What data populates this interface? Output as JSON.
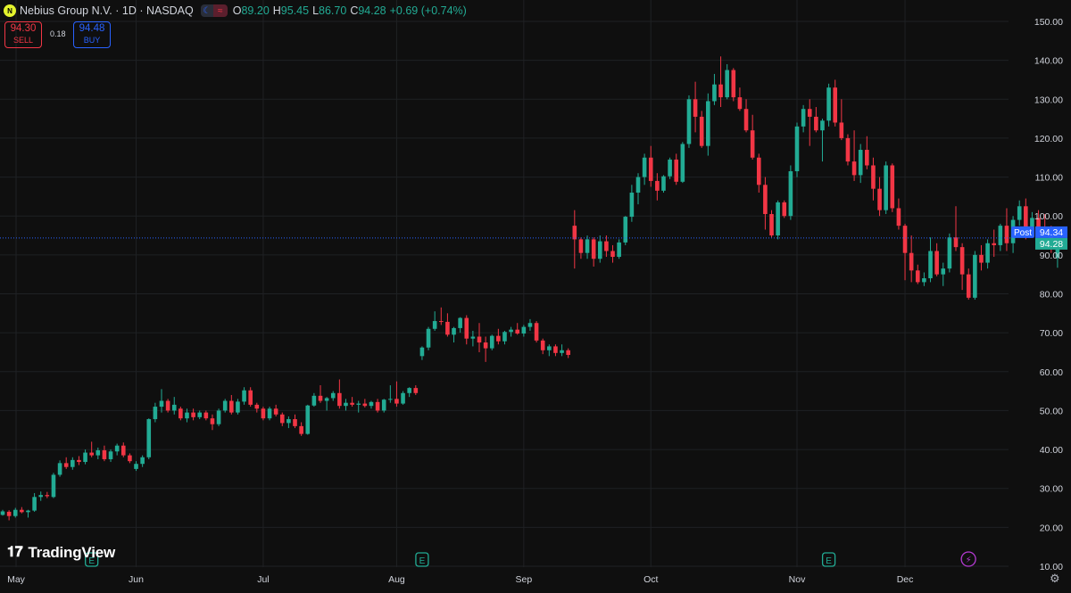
{
  "header": {
    "title": "Nebius Group N.V. · 1D · NASDAQ",
    "logo": "N",
    "o_label": "O",
    "o_value": "89.20",
    "h_label": "H",
    "h_value": "95.45",
    "l_label": "L",
    "l_value": "86.70",
    "c_label": "C",
    "c_value": "94.28",
    "change": "+0.69 (+0.74%)"
  },
  "trade": {
    "sell_price": "94.30",
    "sell_label": "SELL",
    "spread": "0.18",
    "buy_price": "94.48",
    "buy_label": "BUY"
  },
  "brand": "TradingView",
  "icons": [
    "tradingview-logo-icon",
    "gear-icon",
    "earnings-icon",
    "dividend-icon",
    "moon-icon",
    "wave-icon"
  ],
  "colors": {
    "background": "#0f0f0f",
    "up": "#22ab94",
    "down": "#f23645",
    "grid": "#1f2124",
    "post_label": "#2962ff",
    "earnings": "#22ab94",
    "event": "#b53ad3"
  },
  "chart_data": {
    "type": "candlestick",
    "ylim": [
      10,
      150
    ],
    "y_ticks": [
      "10.00",
      "20.00",
      "30.00",
      "40.00",
      "50.00",
      "60.00",
      "70.00",
      "80.00",
      "90.00",
      "100.00",
      "110.00",
      "120.00",
      "130.00",
      "140.00",
      "150.00"
    ],
    "x_ticks": [
      {
        "label": "May",
        "index": 0
      },
      {
        "label": "Jun",
        "index": 21
      },
      {
        "label": "Jul",
        "index": 41
      },
      {
        "label": "Aug",
        "index": 62
      },
      {
        "label": "Sep",
        "index": 82
      },
      {
        "label": "Oct",
        "index": 102
      },
      {
        "label": "Nov",
        "index": 125
      },
      {
        "label": "Dec",
        "index": 142
      }
    ],
    "earnings_markers": [
      {
        "label": "E",
        "index": 14
      },
      {
        "label": "E",
        "index": 66
      },
      {
        "label": "E",
        "index": 130
      }
    ],
    "event_markers": [
      {
        "label": "⚡",
        "index": 151
      }
    ],
    "post_price": {
      "label": "Post",
      "value": 94.34
    },
    "last_price": 94.28,
    "ohlc": [
      [
        23.2,
        24.5,
        23.0,
        24.1
      ],
      [
        24.0,
        24.4,
        21.8,
        22.9
      ],
      [
        22.9,
        25.0,
        22.5,
        24.5
      ],
      [
        24.5,
        25.2,
        23.6,
        23.9
      ],
      [
        23.9,
        24.5,
        22.5,
        24.3
      ],
      [
        24.3,
        28.8,
        24.0,
        27.8
      ],
      [
        27.8,
        29.2,
        26.8,
        28.3
      ],
      [
        28.3,
        29.1,
        27.5,
        28.0
      ],
      [
        27.8,
        34.0,
        27.5,
        33.5
      ],
      [
        33.5,
        37.2,
        33.0,
        36.5
      ],
      [
        36.5,
        38.0,
        35.0,
        35.5
      ],
      [
        35.5,
        38.0,
        34.8,
        37.3
      ],
      [
        37.3,
        38.3,
        36.0,
        36.8
      ],
      [
        36.8,
        40.0,
        36.2,
        39.2
      ],
      [
        39.2,
        42.0,
        38.0,
        38.5
      ],
      [
        38.5,
        40.5,
        37.5,
        39.8
      ],
      [
        39.8,
        41.0,
        37.0,
        37.5
      ],
      [
        37.5,
        40.0,
        36.8,
        39.5
      ],
      [
        39.5,
        41.5,
        38.5,
        41.0
      ],
      [
        41.0,
        41.8,
        38.0,
        38.5
      ],
      [
        38.5,
        39.0,
        36.5,
        37.0
      ],
      [
        35.0,
        37.0,
        34.5,
        36.3
      ],
      [
        36.3,
        38.5,
        35.5,
        38.0
      ],
      [
        38.0,
        48.0,
        37.5,
        47.8
      ],
      [
        47.8,
        52.0,
        47.0,
        51.0
      ],
      [
        51.0,
        55.5,
        49.5,
        52.5
      ],
      [
        52.5,
        53.0,
        49.5,
        50.0
      ],
      [
        50.0,
        53.5,
        49.0,
        51.5
      ],
      [
        50.5,
        51.0,
        47.5,
        48.0
      ],
      [
        48.0,
        50.5,
        47.0,
        49.5
      ],
      [
        49.5,
        50.5,
        47.5,
        48.3
      ],
      [
        48.3,
        50.0,
        47.8,
        49.5
      ],
      [
        49.5,
        50.0,
        47.5,
        48.0
      ],
      [
        48.0,
        49.0,
        45.0,
        46.5
      ],
      [
        46.5,
        50.5,
        46.0,
        50.0
      ],
      [
        50.0,
        53.0,
        49.5,
        52.5
      ],
      [
        52.5,
        54.0,
        49.0,
        49.5
      ],
      [
        49.5,
        53.0,
        49.0,
        52.3
      ],
      [
        52.3,
        56.0,
        51.5,
        55.2
      ],
      [
        55.2,
        56.0,
        51.0,
        51.5
      ],
      [
        51.5,
        52.0,
        49.5,
        50.5
      ],
      [
        50.5,
        51.0,
        47.5,
        48.0
      ],
      [
        48.0,
        51.0,
        47.5,
        50.5
      ],
      [
        50.5,
        51.5,
        48.5,
        49.0
      ],
      [
        49.0,
        49.5,
        46.0,
        46.8
      ],
      [
        46.8,
        48.5,
        45.5,
        47.8
      ],
      [
        47.8,
        49.0,
        45.5,
        46.0
      ],
      [
        46.0,
        47.0,
        43.5,
        44.0
      ],
      [
        44.0,
        51.5,
        43.8,
        51.3
      ],
      [
        51.3,
        54.5,
        51.0,
        53.8
      ],
      [
        53.8,
        56.5,
        52.0,
        52.5
      ],
      [
        52.5,
        53.5,
        50.0,
        53.2
      ],
      [
        53.2,
        55.0,
        52.5,
        54.5
      ],
      [
        54.5,
        58.0,
        50.5,
        51.2
      ],
      [
        51.2,
        53.0,
        50.0,
        52.0
      ],
      [
        52.0,
        53.5,
        51.0,
        51.5
      ],
      [
        51.5,
        52.5,
        49.5,
        51.8
      ],
      [
        51.8,
        53.0,
        50.8,
        51.2
      ],
      [
        51.2,
        52.5,
        50.5,
        52.2
      ],
      [
        52.2,
        53.0,
        49.5,
        50.0
      ],
      [
        50.0,
        53.0,
        49.5,
        52.8
      ],
      [
        52.8,
        56.5,
        52.0,
        53.0
      ],
      [
        53.0,
        57.5,
        51.0,
        51.8
      ],
      [
        51.8,
        55.0,
        51.5,
        54.5
      ],
      [
        54.5,
        56.0,
        53.5,
        55.8
      ],
      [
        55.8,
        56.5,
        54.0,
        54.5
      ],
      [
        64.0,
        66.5,
        63.0,
        66.2
      ],
      [
        66.2,
        71.5,
        65.5,
        71.0
      ],
      [
        71.0,
        75.5,
        70.5,
        73.0
      ],
      [
        73.0,
        76.5,
        72.0,
        72.8
      ],
      [
        72.8,
        75.0,
        69.0,
        69.5
      ],
      [
        69.5,
        71.5,
        67.5,
        71.2
      ],
      [
        71.2,
        74.0,
        70.0,
        73.8
      ],
      [
        73.8,
        74.5,
        67.0,
        68.5
      ],
      [
        68.5,
        70.5,
        66.5,
        69.0
      ],
      [
        69.0,
        72.5,
        65.0,
        67.5
      ],
      [
        67.5,
        69.0,
        62.5,
        66.0
      ],
      [
        66.0,
        69.5,
        65.5,
        69.2
      ],
      [
        69.2,
        71.0,
        67.0,
        67.8
      ],
      [
        67.8,
        70.5,
        67.0,
        70.2
      ],
      [
        70.2,
        71.5,
        69.0,
        70.8
      ],
      [
        70.8,
        72.5,
        69.5,
        69.8
      ],
      [
        69.8,
        72.0,
        69.0,
        71.5
      ],
      [
        71.5,
        73.5,
        70.5,
        72.5
      ],
      [
        72.5,
        73.0,
        67.5,
        68.0
      ],
      [
        68.0,
        68.5,
        64.5,
        65.5
      ],
      [
        65.5,
        67.0,
        64.0,
        66.5
      ],
      [
        66.5,
        67.0,
        64.0,
        64.8
      ],
      [
        64.8,
        67.0,
        64.0,
        65.5
      ],
      [
        65.5,
        66.0,
        63.5,
        64.3
      ],
      [
        97.5,
        101.5,
        86.5,
        94.0
      ],
      [
        94.0,
        94.5,
        89.0,
        90.5
      ],
      [
        90.5,
        95.0,
        89.0,
        94.0
      ],
      [
        94.0,
        94.5,
        87.0,
        89.0
      ],
      [
        89.0,
        95.0,
        88.0,
        93.5
      ],
      [
        93.5,
        95.0,
        89.5,
        91.0
      ],
      [
        91.0,
        92.5,
        88.0,
        89.5
      ],
      [
        89.5,
        94.0,
        89.0,
        93.2
      ],
      [
        93.2,
        100.0,
        92.5,
        99.8
      ],
      [
        99.8,
        108.0,
        98.5,
        106.0
      ],
      [
        106.0,
        111.0,
        103.0,
        110.0
      ],
      [
        110.0,
        116.0,
        108.0,
        115.0
      ],
      [
        115.0,
        118.0,
        107.5,
        109.0
      ],
      [
        109.0,
        111.0,
        104.0,
        106.5
      ],
      [
        106.5,
        110.5,
        106.0,
        110.2
      ],
      [
        110.2,
        115.0,
        109.5,
        114.5
      ],
      [
        114.5,
        116.0,
        108.0,
        108.8
      ],
      [
        108.8,
        119.0,
        108.5,
        118.5
      ],
      [
        118.5,
        131.0,
        117.5,
        130.0
      ],
      [
        130.0,
        134.5,
        121.5,
        125.5
      ],
      [
        125.5,
        127.0,
        117.5,
        118.0
      ],
      [
        118.0,
        131.5,
        115.5,
        129.5
      ],
      [
        129.5,
        136.5,
        128.5,
        133.8
      ],
      [
        133.8,
        141.0,
        128.0,
        130.5
      ],
      [
        130.5,
        139.0,
        130.0,
        137.5
      ],
      [
        137.5,
        138.0,
        129.5,
        130.5
      ],
      [
        130.5,
        133.0,
        127.0,
        127.5
      ],
      [
        127.5,
        130.0,
        121.5,
        122.0
      ],
      [
        122.0,
        126.0,
        114.5,
        115.0
      ],
      [
        115.0,
        116.0,
        106.0,
        108.0
      ],
      [
        108.0,
        110.0,
        96.5,
        100.5
      ],
      [
        100.5,
        101.5,
        94.5,
        95.0
      ],
      [
        95.0,
        104.0,
        94.0,
        103.5
      ],
      [
        103.5,
        104.0,
        99.5,
        100.0
      ],
      [
        100.0,
        113.0,
        99.0,
        111.5
      ],
      [
        111.5,
        124.0,
        110.0,
        123.0
      ],
      [
        123.0,
        128.5,
        121.5,
        127.5
      ],
      [
        127.5,
        130.0,
        118.0,
        125.5
      ],
      [
        125.5,
        128.0,
        121.5,
        122.0
      ],
      [
        122.0,
        125.0,
        114.0,
        124.5
      ],
      [
        124.5,
        134.0,
        123.0,
        133.0
      ],
      [
        133.0,
        135.0,
        123.0,
        124.0
      ],
      [
        124.0,
        130.0,
        119.5,
        120.0
      ],
      [
        120.0,
        121.0,
        113.0,
        114.0
      ],
      [
        114.0,
        122.0,
        109.0,
        110.5
      ],
      [
        110.5,
        118.5,
        108.5,
        117.0
      ],
      [
        117.0,
        120.5,
        112.0,
        113.0
      ],
      [
        113.0,
        115.0,
        104.0,
        107.0
      ],
      [
        107.0,
        110.0,
        100.0,
        101.5
      ],
      [
        101.5,
        114.0,
        100.5,
        113.0
      ],
      [
        113.0,
        113.5,
        101.0,
        102.0
      ],
      [
        102.0,
        104.5,
        96.5,
        97.5
      ],
      [
        97.5,
        98.0,
        83.5,
        90.5
      ],
      [
        90.5,
        95.0,
        83.0,
        86.0
      ],
      [
        86.0,
        87.5,
        82.5,
        83.0
      ],
      [
        83.0,
        85.5,
        82.0,
        84.0
      ],
      [
        84.0,
        94.5,
        83.0,
        91.0
      ],
      [
        91.0,
        93.0,
        84.5,
        85.0
      ],
      [
        85.0,
        88.0,
        82.0,
        86.5
      ],
      [
        86.5,
        95.5,
        85.5,
        94.5
      ],
      [
        94.5,
        102.5,
        91.0,
        92.0
      ],
      [
        92.0,
        93.0,
        81.0,
        85.0
      ],
      [
        85.0,
        86.5,
        78.5,
        79.0
      ],
      [
        79.0,
        91.0,
        78.5,
        90.0
      ],
      [
        90.0,
        92.5,
        86.0,
        88.0
      ],
      [
        88.0,
        94.0,
        86.5,
        93.0
      ],
      [
        93.0,
        96.5,
        89.5,
        92.5
      ],
      [
        92.5,
        98.0,
        91.0,
        97.5
      ],
      [
        97.5,
        102.0,
        91.0,
        93.0
      ],
      [
        93.0,
        100.0,
        90.5,
        99.0
      ],
      [
        99.0,
        104.0,
        97.5,
        102.5
      ],
      [
        102.5,
        104.5,
        94.0,
        95.0
      ],
      [
        95.0,
        101.0,
        94.5,
        99.5
      ],
      [
        99.5,
        101.5,
        96.0,
        97.0
      ],
      [
        97.0,
        100.5,
        95.0,
        96.5
      ],
      [
        96.5,
        97.5,
        90.5,
        92.5
      ],
      [
        89.2,
        95.45,
        86.7,
        94.28
      ]
    ]
  }
}
